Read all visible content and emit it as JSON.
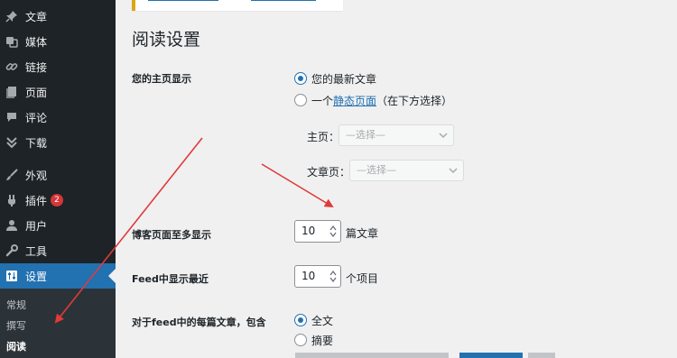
{
  "sidebar": {
    "items": [
      {
        "label": "文章",
        "icon": "pin-icon"
      },
      {
        "label": "媒体",
        "icon": "media-icon"
      },
      {
        "label": "链接",
        "icon": "link-icon"
      },
      {
        "label": "页面",
        "icon": "page-icon"
      },
      {
        "label": "评论",
        "icon": "comment-icon"
      },
      {
        "label": "下载",
        "icon": "download-icon"
      },
      {
        "label": "外观",
        "icon": "brush-icon"
      },
      {
        "label": "插件",
        "icon": "plugin-icon",
        "badge": "2"
      },
      {
        "label": "用户",
        "icon": "user-icon"
      },
      {
        "label": "工具",
        "icon": "wrench-icon"
      },
      {
        "label": "设置",
        "icon": "settings-icon"
      }
    ],
    "submenu": [
      "常规",
      "撰写",
      "阅读"
    ]
  },
  "page": {
    "title": "阅读设置"
  },
  "homepage": {
    "label": "您的主页显示",
    "option_latest": "您的最新文章",
    "option_static_prefix": "一个",
    "option_static_link": "静态页面",
    "option_static_suffix": "（在下方选择）",
    "front_label": "主页：",
    "front_placeholder": "—选择—",
    "posts_label": "文章页：",
    "posts_placeholder": "—选择—"
  },
  "posts_per_page": {
    "label": "博客页面至多显示",
    "value": "10",
    "suffix": "篇文章"
  },
  "feed": {
    "label": "Feed中显示最近",
    "value": "10",
    "suffix": "个项目"
  },
  "feed_content": {
    "label": "对于feed中的每篇文章，包含",
    "option_full": "全文",
    "option_summary": "摘要"
  },
  "colors": {
    "sidebar_bg": "#1d2327",
    "accent": "#2271b1",
    "annotation": "#e03a3a",
    "badge": "#d63638"
  }
}
